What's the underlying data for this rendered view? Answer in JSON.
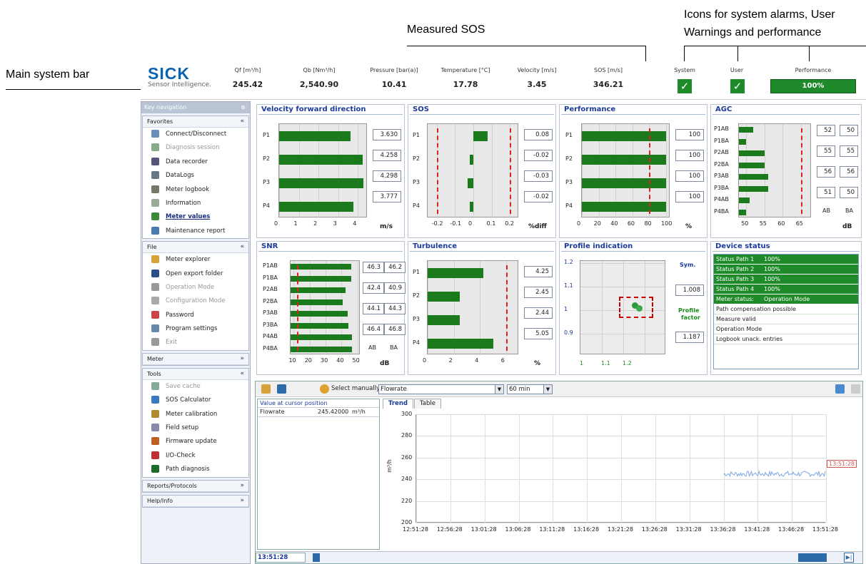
{
  "annotations": {
    "main_system_bar": "Main system bar",
    "measured_sos": "Measured SOS",
    "icons_line1": "Icons for system alarms, User",
    "icons_line2": "Warnings and performance"
  },
  "logo": {
    "brand": "SICK",
    "tagline": "Sensor Intelligence."
  },
  "sysbar": {
    "metrics": [
      {
        "label": "Qf [m³/h]",
        "value": "245.42"
      },
      {
        "label": "Qb [Nm³/h]",
        "value": "2,540.90"
      },
      {
        "label": "Pressure [bar(a)]",
        "value": "10.41"
      },
      {
        "label": "Temperature [°C]",
        "value": "17.78"
      },
      {
        "label": "Velocity [m/s]",
        "value": "3.45"
      },
      {
        "label": "SOS [m/s]",
        "value": "346.21"
      }
    ],
    "system_label": "System",
    "user_label": "User",
    "performance_label": "Performance",
    "performance_value": "100%",
    "check_icon": "check-icon"
  },
  "sidebar": {
    "header": "Key navigation",
    "pin": "⊕",
    "sections": {
      "favorites": {
        "title": "Favorites",
        "items": [
          {
            "label": "Connect/Disconnect"
          },
          {
            "label": "Diagnosis session"
          },
          {
            "label": "Data recorder"
          },
          {
            "label": "DataLogs"
          },
          {
            "label": "Meter logbook"
          },
          {
            "label": "Information"
          },
          {
            "label": "Meter values"
          },
          {
            "label": "Maintenance report"
          }
        ]
      },
      "file": {
        "title": "File",
        "items": [
          {
            "label": "Meter explorer"
          },
          {
            "label": "Open export folder"
          },
          {
            "label": "Operation Mode"
          },
          {
            "label": "Configuration Mode"
          },
          {
            "label": "Password"
          },
          {
            "label": "Program settings"
          },
          {
            "label": "Exit"
          }
        ]
      },
      "meter": {
        "title": "Meter"
      },
      "tools": {
        "title": "Tools",
        "items": [
          {
            "label": "Save cache"
          },
          {
            "label": "SOS Calculator"
          },
          {
            "label": "Meter calibration"
          },
          {
            "label": "Field setup"
          },
          {
            "label": "Firmware update"
          },
          {
            "label": "I/O-Check"
          },
          {
            "label": "Path diagnosis"
          }
        ]
      },
      "reports": {
        "title": "Reports/Protocols"
      },
      "help": {
        "title": "Help/Info"
      }
    }
  },
  "panels": {
    "velocity": {
      "title": "Velocity  forward direction",
      "unit": "m/s",
      "ticks": [
        "0",
        "1",
        "2",
        "3",
        "4"
      ],
      "paths": [
        "P1",
        "P2",
        "P3",
        "P4"
      ],
      "values": [
        "3.630",
        "4.258",
        "4.298",
        "3.777"
      ]
    },
    "sos": {
      "title": "SOS",
      "unit": "%diff",
      "ticks": [
        "-0.2",
        "-0.1",
        "0",
        "0.1",
        "0.2"
      ],
      "paths": [
        "P1",
        "P2",
        "P3",
        "P4"
      ],
      "values": [
        "0.08",
        "-0.02",
        "-0.03",
        "-0.02"
      ]
    },
    "performance": {
      "title": "Performance",
      "unit": "%",
      "ticks": [
        "0",
        "20",
        "40",
        "60",
        "80",
        "100"
      ],
      "paths": [
        "P1",
        "P2",
        "P3",
        "P4"
      ],
      "values": [
        "100",
        "100",
        "100",
        "100"
      ]
    },
    "agc": {
      "title": "AGC",
      "unit": "dB",
      "ticks": [
        "50",
        "55",
        "60",
        "65"
      ],
      "paths": [
        "P1AB",
        "P1BA",
        "P2AB",
        "P2BA",
        "P3AB",
        "P3BA",
        "P4AB",
        "P4BA"
      ],
      "valuesAB": [
        "52",
        "55",
        "56",
        "51"
      ],
      "valuesBA": [
        "50",
        "55",
        "56",
        "50"
      ],
      "col_ab": "AB",
      "col_ba": "BA"
    },
    "snr": {
      "title": "SNR",
      "unit": "dB",
      "ticks": [
        "10",
        "20",
        "30",
        "40",
        "50"
      ],
      "paths": [
        "P1AB",
        "P1BA",
        "P2AB",
        "P2BA",
        "P3AB",
        "P3BA",
        "P4AB",
        "P4BA"
      ],
      "valuesAB": [
        "46.3",
        "42.4",
        "44.1",
        "46.4"
      ],
      "valuesBA": [
        "46.2",
        "40.9",
        "44.3",
        "46.8"
      ],
      "col_ab": "AB",
      "col_ba": "BA"
    },
    "turbulence": {
      "title": "Turbulence",
      "unit": "%",
      "ticks": [
        "0",
        "2",
        "4",
        "6"
      ],
      "paths": [
        "P1",
        "P2",
        "P3",
        "P4"
      ],
      "values": [
        "4.25",
        "2.45",
        "2.44",
        "5.05"
      ]
    },
    "profile": {
      "title": "Profile indication",
      "yticks": [
        "1.2",
        "1.1",
        "1",
        "0.9"
      ],
      "xticks": [
        "1",
        "1.1",
        "1.2"
      ],
      "sym_label": "Sym.",
      "sym_value": "1.008",
      "pf_label1": "Profile",
      "pf_label2": "factor",
      "pf_value": "1.187"
    },
    "device": {
      "title": "Device status",
      "rows": [
        {
          "label": "Status Path 1",
          "value": "100%",
          "ok": true
        },
        {
          "label": "Status Path 2",
          "value": "100%",
          "ok": true
        },
        {
          "label": "Status Path 3",
          "value": "100%",
          "ok": true
        },
        {
          "label": "Status Path 4",
          "value": "100%",
          "ok": true
        },
        {
          "label": "Meter status:",
          "value": "Operation Mode",
          "ok": true
        },
        {
          "label": "Path compensation possible",
          "value": "",
          "ok": false
        },
        {
          "label": "Measure valid",
          "value": "",
          "ok": false
        },
        {
          "label": "Operation Mode",
          "value": "",
          "ok": false
        },
        {
          "label": "Logbook unack. entries",
          "value": "",
          "ok": false
        }
      ]
    }
  },
  "trend": {
    "select_label": "Select manually",
    "select_value": "Flowrate",
    "range_value": "60 min",
    "cursor_header": "Value at cursor position",
    "cursor_name": "Flowrate",
    "cursor_value": "245.42000",
    "cursor_unit": "m³/h",
    "tab_trend": "Trend",
    "tab_table": "Table",
    "time_field": "13:51:28",
    "cursor_time": "13:51:28"
  },
  "chart_data": {
    "type": "line",
    "ylabel": "m³/h",
    "ylim": [
      200,
      300
    ],
    "yticks": [
      "300",
      "280",
      "260",
      "240",
      "220",
      "200"
    ],
    "x": [
      "12:51:28",
      "12:56:28",
      "13:01:28",
      "13:06:28",
      "13:11:28",
      "13:16:28",
      "13:21:28",
      "13:26:28",
      "13:31:28",
      "13:36:28",
      "13:41:28",
      "13:46:28",
      "13:51:28"
    ],
    "series": [
      {
        "values_start": "13:36:28",
        "approx_value": 245
      }
    ],
    "grid": true
  }
}
